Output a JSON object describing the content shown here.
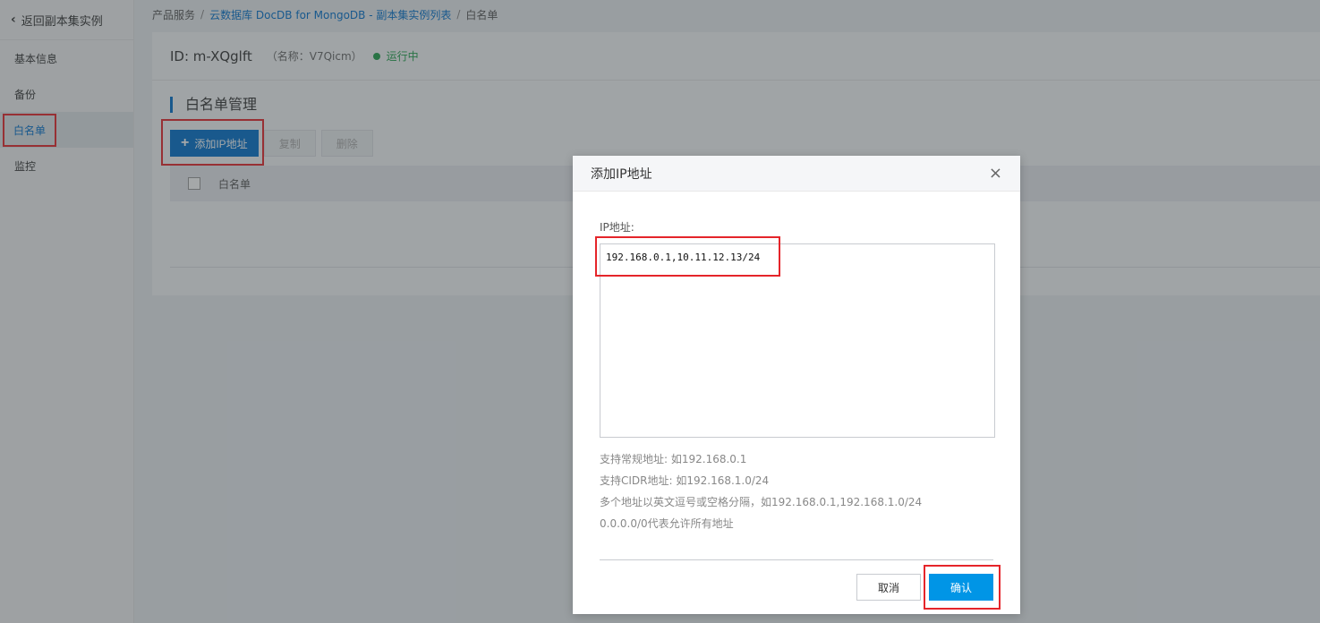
{
  "sidebar": {
    "back_label": "返回副本集实例",
    "items": [
      {
        "label": "基本信息"
      },
      {
        "label": "备份"
      },
      {
        "label": "白名单"
      },
      {
        "label": "监控"
      }
    ]
  },
  "breadcrumb": {
    "root": "产品服务",
    "service": "云数据库 DocDB for MongoDB - 副本集实例列表",
    "current": "白名单",
    "separator": "/"
  },
  "instance": {
    "id": "ID: m-XQglft",
    "name": "（名称：V7Qicm）",
    "status": "运行中",
    "status_color": "#1e9e4a"
  },
  "whitelist": {
    "title": "白名单管理",
    "add_button": "添加IP地址",
    "copy_button": "复制",
    "delete_button": "删除",
    "column_header": "白名单"
  },
  "dialog": {
    "title": "添加IP地址",
    "field_label": "IP地址:",
    "ip_value": "192.168.0.1,10.11.12.13/24",
    "hints": [
      "支持常规地址: 如192.168.0.1",
      "支持CIDR地址: 如192.168.1.0/24",
      "多个地址以英文逗号或空格分隔，如192.168.0.1,192.168.1.0/24",
      "0.0.0.0/0代表允许所有地址"
    ],
    "cancel_button": "取消",
    "confirm_button": "确认"
  },
  "colors": {
    "primary": "#0070cc",
    "highlight": "#e5252a"
  }
}
